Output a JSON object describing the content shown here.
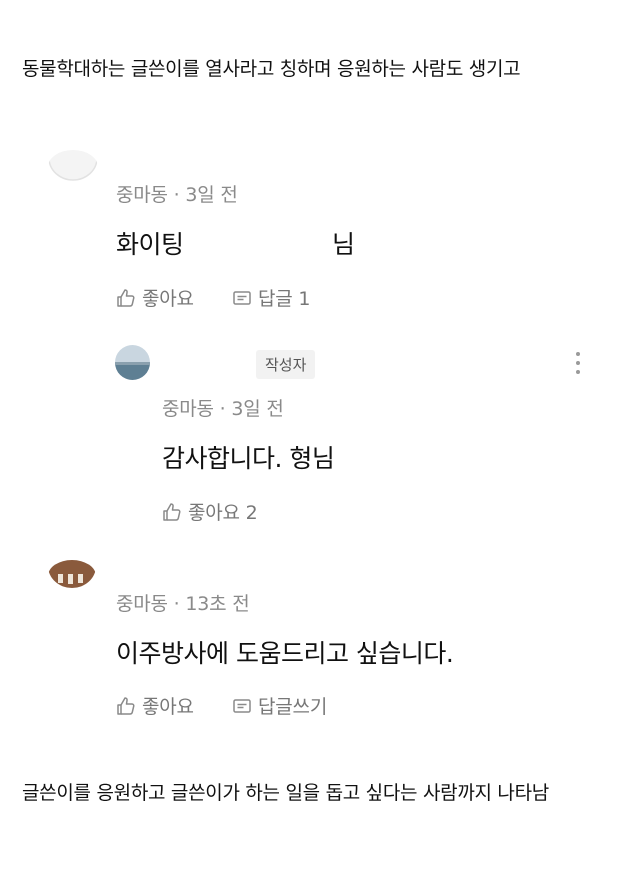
{
  "captions": {
    "top": "동물학대하는 글쓴이를 열사라고 칭하며 응원하는 사람도 생기고",
    "bottom": "글쓴이를 응원하고 글쓴이가 하는 일을 돕고 싶다는 사람까지 나타남"
  },
  "comments": [
    {
      "author": "중마동",
      "time": "3일 전",
      "text_a": "화이팅",
      "text_b": "님",
      "like_label": "좋아요",
      "reply_label": "답글 1"
    },
    {
      "badge": "작성자",
      "author": "중마동",
      "time": "3일 전",
      "text": "감사합니다. 형님",
      "like_label": "좋아요 2"
    },
    {
      "author": "중마동",
      "time": "13초 전",
      "text": "이주방사에 도움드리고 싶습니다.",
      "like_label": "좋아요",
      "reply_label": "답글쓰기"
    }
  ],
  "icons": {
    "like": "thumbs-up-icon",
    "reply": "comment-icon",
    "more": "more-vertical-icon"
  },
  "colors": {
    "meta": "#8a8a8a",
    "badge_bg": "#f2f2f2"
  }
}
